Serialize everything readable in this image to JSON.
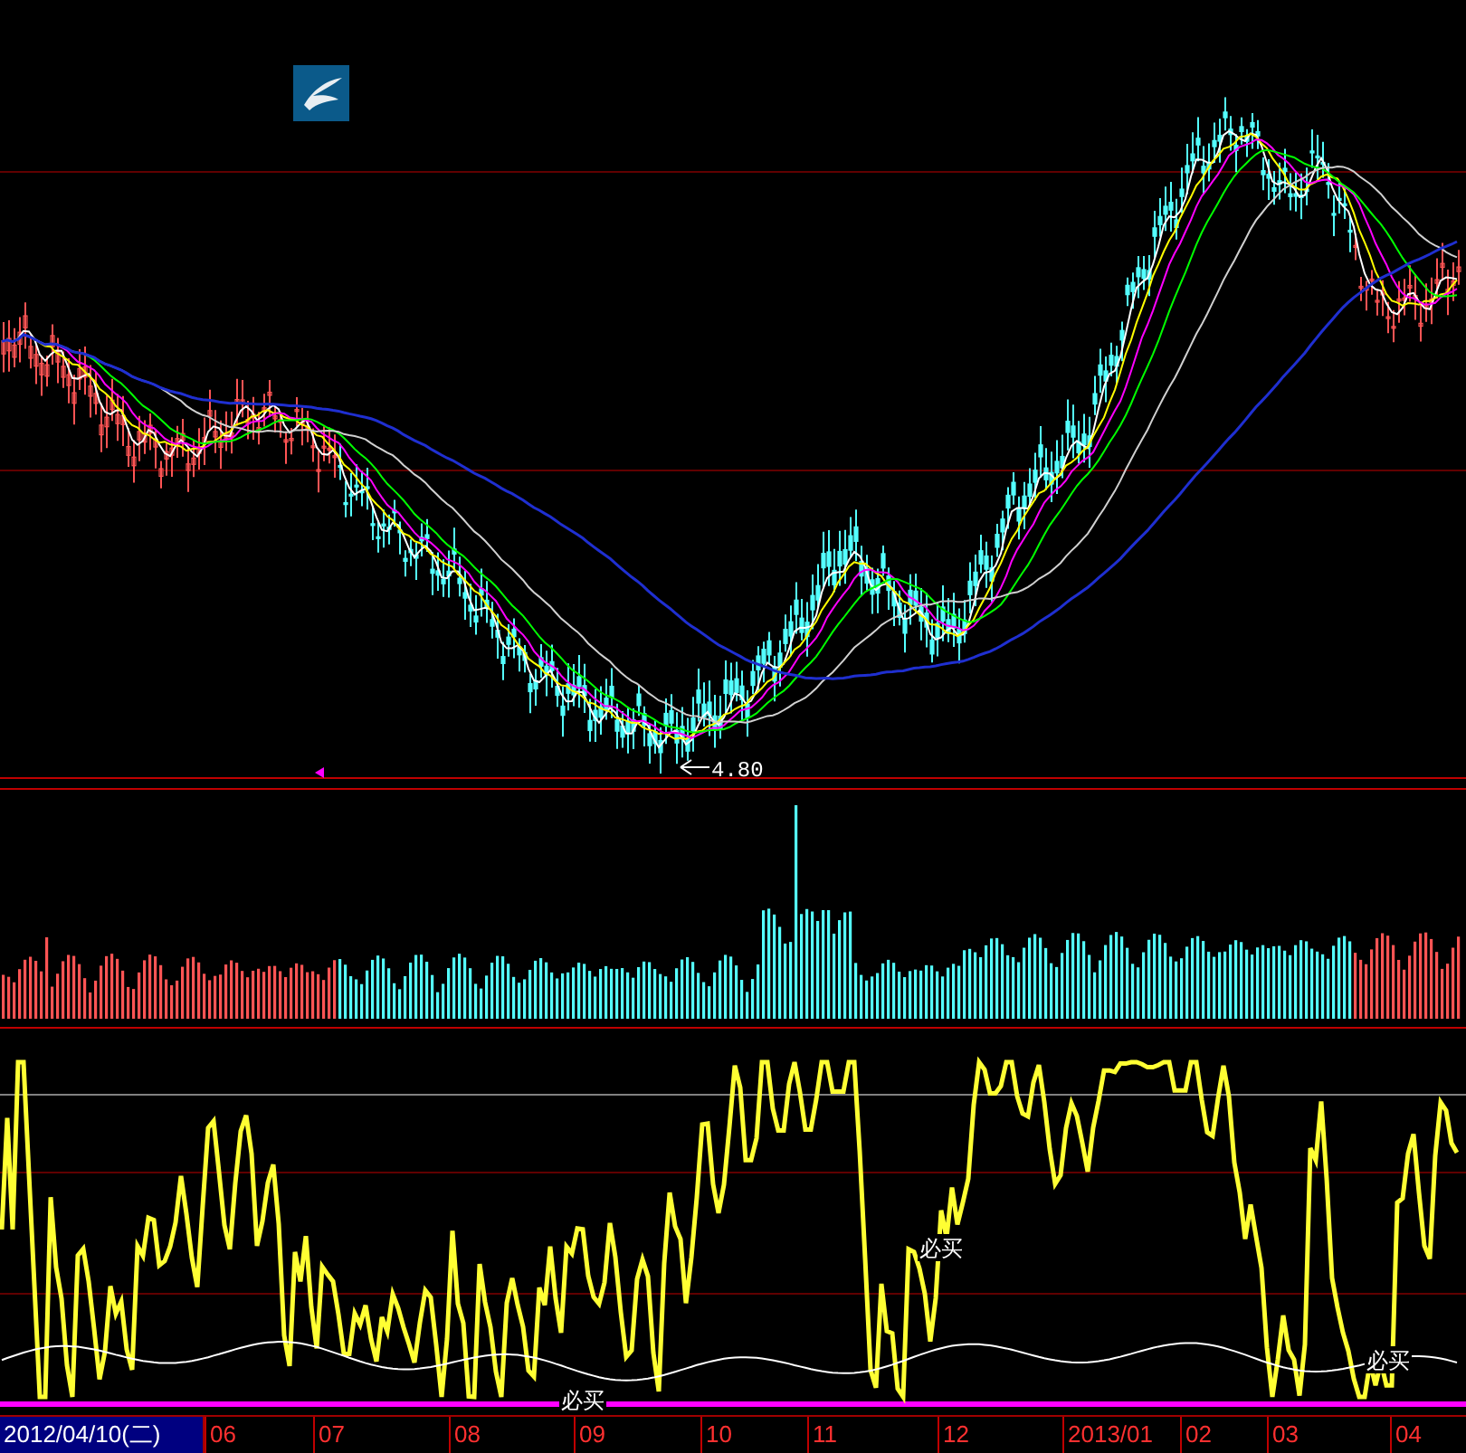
{
  "price_panel": {
    "low_marker": "4.80"
  },
  "indicator_panel": {
    "signals": [
      "必买",
      "必买",
      "必买"
    ]
  },
  "time_axis": {
    "current_date": "2012/04/10(二)",
    "months": [
      "06",
      "07",
      "08",
      "09",
      "10",
      "11",
      "12",
      "2013/01",
      "02",
      "03",
      "04"
    ]
  }
}
